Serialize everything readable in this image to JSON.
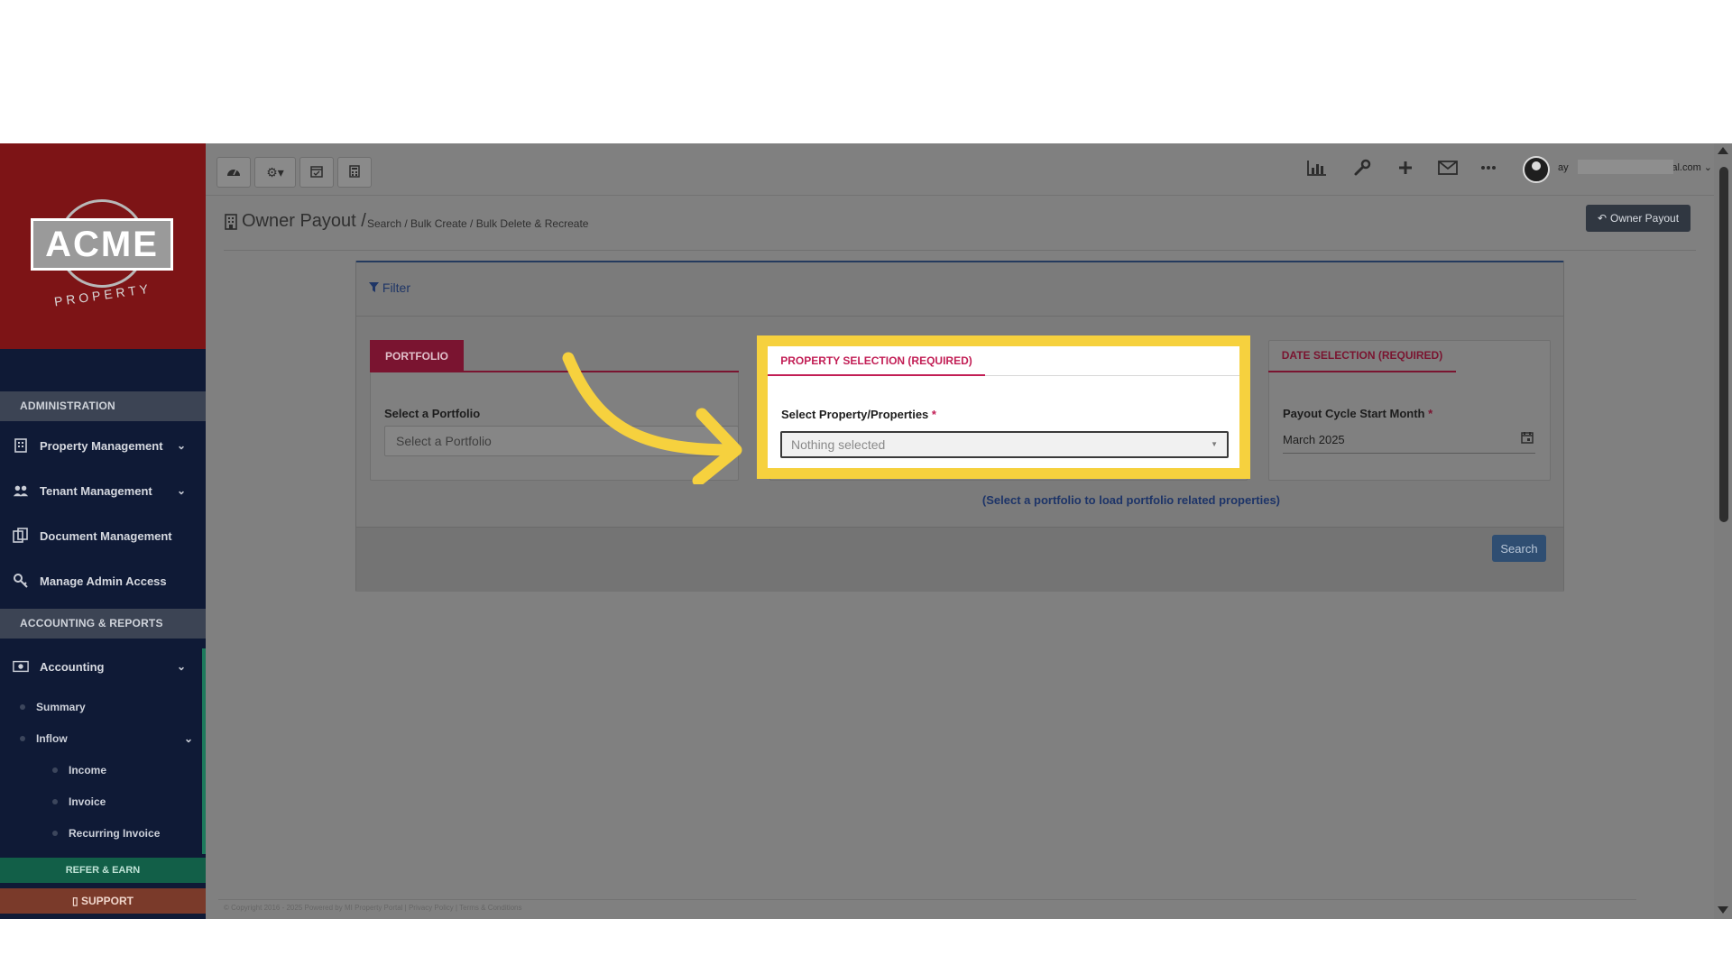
{
  "logo": {
    "brand": "ACME",
    "sub": "PROPERTY"
  },
  "sidebar": {
    "sections": {
      "administration": "ADMINISTRATION",
      "accounting_reports": "ACCOUNTING & REPORTS"
    },
    "items": [
      {
        "label": "Property Management",
        "icon": "building-icon"
      },
      {
        "label": "Tenant Management",
        "icon": "users-icon"
      },
      {
        "label": "Document Management",
        "icon": "documents-icon"
      },
      {
        "label": "Manage Admin Access",
        "icon": "key-icon"
      },
      {
        "label": "Accounting",
        "icon": "money-icon"
      }
    ],
    "sub_items": {
      "summary": "Summary",
      "inflow": "Inflow",
      "income": "Income",
      "invoice": "Invoice",
      "recurring_invoice": "Recurring Invoice"
    },
    "refer": "REFER & EARN",
    "support": "SUPPORT"
  },
  "topbar": {
    "left_icons": [
      "dashboard-icon",
      "gear-icon",
      "calendar-icon",
      "calculator-icon"
    ],
    "right_icons": [
      "bar-chart-icon",
      "wrench-icon",
      "plus-icon",
      "mail-icon",
      "more-icon"
    ],
    "email_prefix": "ay",
    "email_suffix": "rtal.com"
  },
  "header": {
    "title": "Owner Payout",
    "separator": "/",
    "breadcrumb": "Search / Bulk Create / Bulk Delete & Recreate",
    "back_button": "Owner Payout"
  },
  "filter": {
    "title": "Filter",
    "portfolio_tab": "PORTFOLIO",
    "portfolio_label": "Select a Portfolio",
    "portfolio_placeholder": "Select a Portfolio",
    "property_tab": "PROPERTY SELECTION (REQUIRED)",
    "property_label": "Select Property/Properties",
    "property_value": "Nothing selected",
    "required_mark": "*",
    "date_tab": "DATE SELECTION (REQUIRED)",
    "date_label": "Payout Cycle Start Month",
    "date_value": "March 2025",
    "hint": "(Select a portfolio to load portfolio related properties)",
    "search_button": "Search"
  },
  "footer": {
    "text": "© Copyright 2016 - 2025 Powered by MI Property Portal | Privacy Policy | Terms & Conditions"
  },
  "colors": {
    "accent_yellow": "#f6d13e",
    "required_red": "#c21e55",
    "sidebar_navy": "#0f1a36",
    "logo_red": "#7d1416"
  }
}
